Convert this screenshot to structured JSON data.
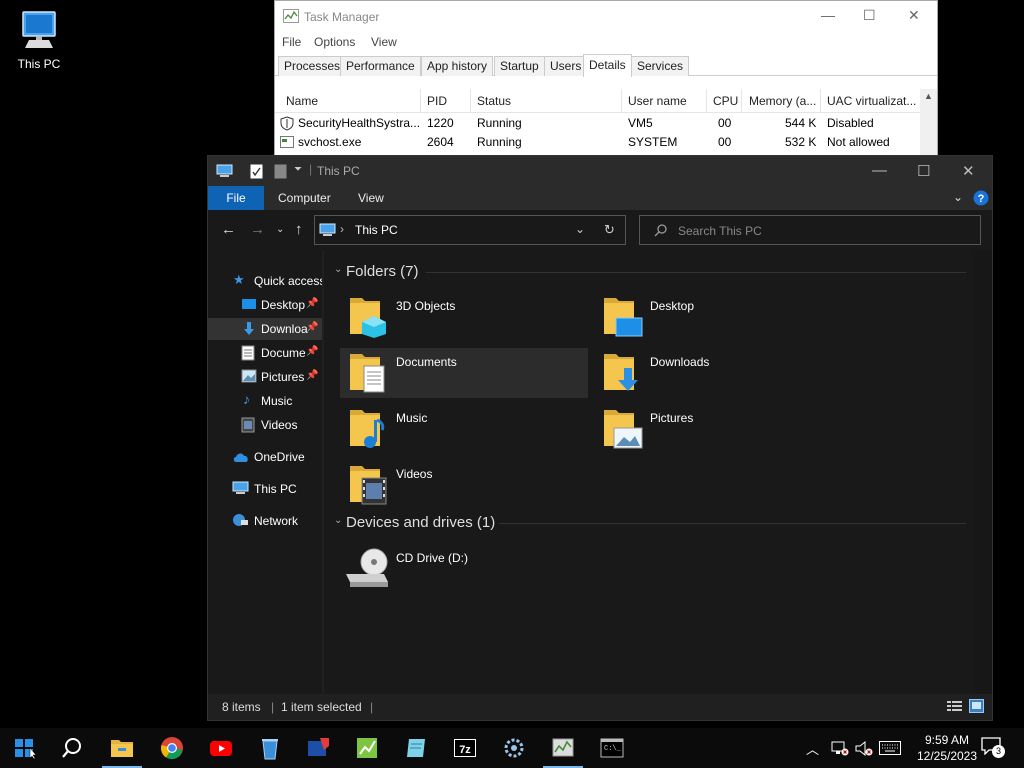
{
  "desktop": {
    "icons": [
      {
        "label": "This PC",
        "icon": "this-pc-icon"
      }
    ]
  },
  "task_manager": {
    "title": "Task Manager",
    "menu": [
      "File",
      "Options",
      "View"
    ],
    "tabs": [
      "Processes",
      "Performance",
      "App history",
      "Startup",
      "Users",
      "Details",
      "Services"
    ],
    "active_tab": "Details",
    "columns": [
      "Name",
      "PID",
      "Status",
      "User name",
      "CPU",
      "Memory (a...",
      "UAC virtualizat..."
    ],
    "rows": [
      {
        "name": "SecurityHealthSystra...",
        "pid": "1220",
        "status": "Running",
        "user": "VM5",
        "cpu": "00",
        "memory": "544 K",
        "uac": "Disabled"
      },
      {
        "name": "svchost.exe",
        "pid": "2604",
        "status": "Running",
        "user": "SYSTEM",
        "cpu": "00",
        "memory": "532 K",
        "uac": "Not allowed"
      }
    ]
  },
  "explorer": {
    "title": "This PC",
    "ribbon": {
      "file": "File",
      "tabs": [
        "Computer",
        "View"
      ]
    },
    "address": {
      "path": "This PC"
    },
    "search": {
      "placeholder": "Search This PC"
    },
    "sidebar": [
      {
        "label": "Quick access",
        "icon": "star-icon"
      },
      {
        "label": "Desktop",
        "icon": "desktop-folder-icon",
        "pinned": true
      },
      {
        "label": "Downloa",
        "icon": "downloads-icon",
        "pinned": true,
        "selected": true
      },
      {
        "label": "Docume",
        "icon": "documents-icon",
        "pinned": true
      },
      {
        "label": "Pictures",
        "icon": "pictures-icon",
        "pinned": true
      },
      {
        "label": "Music",
        "icon": "music-icon"
      },
      {
        "label": "Videos",
        "icon": "videos-icon"
      },
      {
        "label": "OneDrive",
        "icon": "onedrive-icon"
      },
      {
        "label": "This PC",
        "icon": "this-pc-icon"
      },
      {
        "label": "Network",
        "icon": "network-icon"
      }
    ],
    "groups": {
      "folders": {
        "title": "Folders (7)"
      },
      "devices": {
        "title": "Devices and drives (1)"
      }
    },
    "folders": [
      {
        "label": "3D Objects",
        "icon": "3d-objects-folder-icon"
      },
      {
        "label": "Desktop",
        "icon": "desktop-folder-icon"
      },
      {
        "label": "Documents",
        "icon": "documents-folder-icon",
        "selected": true
      },
      {
        "label": "Downloads",
        "icon": "downloads-folder-icon"
      },
      {
        "label": "Music",
        "icon": "music-folder-icon"
      },
      {
        "label": "Pictures",
        "icon": "pictures-folder-icon"
      },
      {
        "label": "Videos",
        "icon": "videos-folder-icon"
      }
    ],
    "drives": [
      {
        "label": "CD Drive (D:)",
        "icon": "cd-drive-icon"
      }
    ],
    "status": {
      "items": "8 items",
      "selected": "1 item selected"
    }
  },
  "taskbar": {
    "apps": [
      "start-icon",
      "search-icon",
      "file-explorer-icon",
      "chrome-icon",
      "youtube-icon",
      "recycle-bin-icon",
      "app-icon",
      "spreadsheet-icon",
      "notepad-icon",
      "7zip-icon",
      "settings-gear-icon",
      "task-manager-icon",
      "terminal-icon"
    ],
    "clock": {
      "time": "9:59 AM",
      "date": "12/25/2023"
    },
    "notifications": "3"
  },
  "colors": {
    "accent": "#0e63b5",
    "folder": "#f4c64e",
    "explorer_bg": "#191919"
  }
}
